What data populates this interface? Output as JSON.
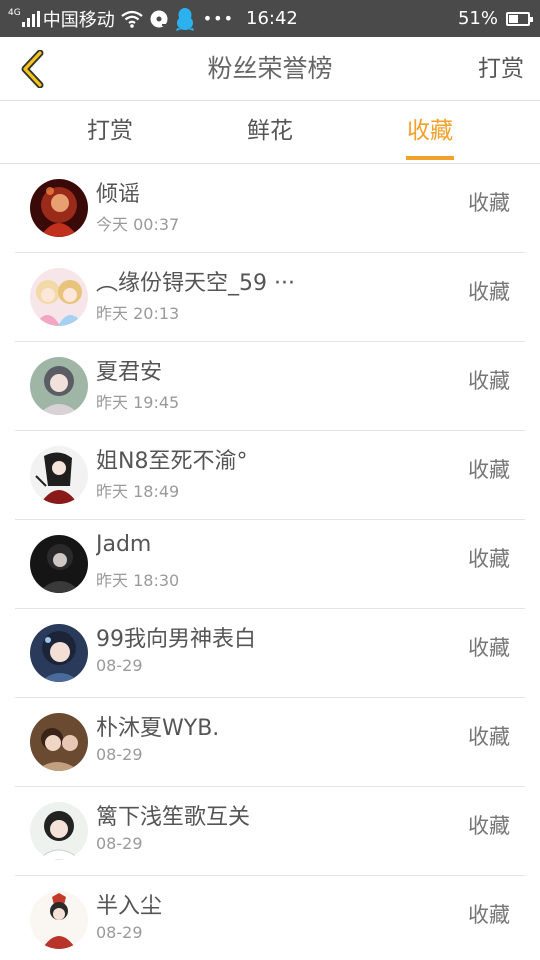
{
  "status_bar": {
    "network": "4G",
    "carrier": "中国移动",
    "time": "16:42",
    "battery_percent": "51%",
    "battery_level": 0.51,
    "icons": [
      "signal-icon",
      "wifi-icon",
      "music-disc-icon",
      "qq-penguin-icon",
      "more-dots-icon",
      "battery-icon"
    ]
  },
  "header": {
    "title": "粉丝荣誉榜",
    "right_action": "打赏"
  },
  "tabs": [
    {
      "label": "打赏",
      "active": false
    },
    {
      "label": "鲜花",
      "active": false
    },
    {
      "label": "收藏",
      "active": true
    }
  ],
  "accent_color": "#f2a12c",
  "fans": [
    {
      "name": "倾谣",
      "time": "今天 00:37",
      "action": "收藏"
    },
    {
      "name": "︵缘份锝天空_59 ···",
      "time": "昨天 20:13",
      "action": "收藏"
    },
    {
      "name": "夏君安",
      "time": "昨天 19:45",
      "action": "收藏"
    },
    {
      "name": "姐N8至死不渝°",
      "time": "昨天 18:49",
      "action": "收藏"
    },
    {
      "name": "Jadm",
      "time": "昨天 18:30",
      "action": "收藏"
    },
    {
      "name": "99我向男神表白",
      "time": "08-29",
      "action": "收藏"
    },
    {
      "name": "朴沐夏WYB.",
      "time": "08-29",
      "action": "收藏"
    },
    {
      "name": "篱下浅笙歌互关",
      "time": "08-29",
      "action": "收藏"
    },
    {
      "name": "半入尘",
      "time": "08-29",
      "action": "收藏"
    }
  ]
}
